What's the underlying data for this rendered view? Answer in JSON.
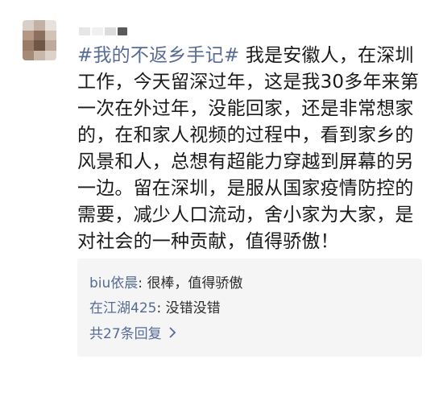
{
  "post": {
    "hashtag": "#我的不返乡手记#",
    "text": " 我是安徽人，在深圳工作，今天留深过年，这是我30多年来第一次在外过年，没能回家，还是非常想家的，在和家人视频的过程中，看到家乡的风景和人，总想有超能力穿越到屏幕的另一边。留在深圳，是服从国家疫情防控的需要，减少人口流动，舍小家为大家，是对社会的一种贡献，值得骄傲！"
  },
  "comments": [
    {
      "author": "biu依晨",
      "separator": ": ",
      "text": "很棒，值得骄傲"
    },
    {
      "author": "在江湖425",
      "separator": ": ",
      "text": "没错没错"
    }
  ],
  "more_replies": {
    "label": "共27条回复",
    "icon": "chevron-right-icon"
  },
  "colors": {
    "link": "#576b95",
    "comment_bg": "#f5f5f5",
    "text": "#1a1a1a"
  }
}
